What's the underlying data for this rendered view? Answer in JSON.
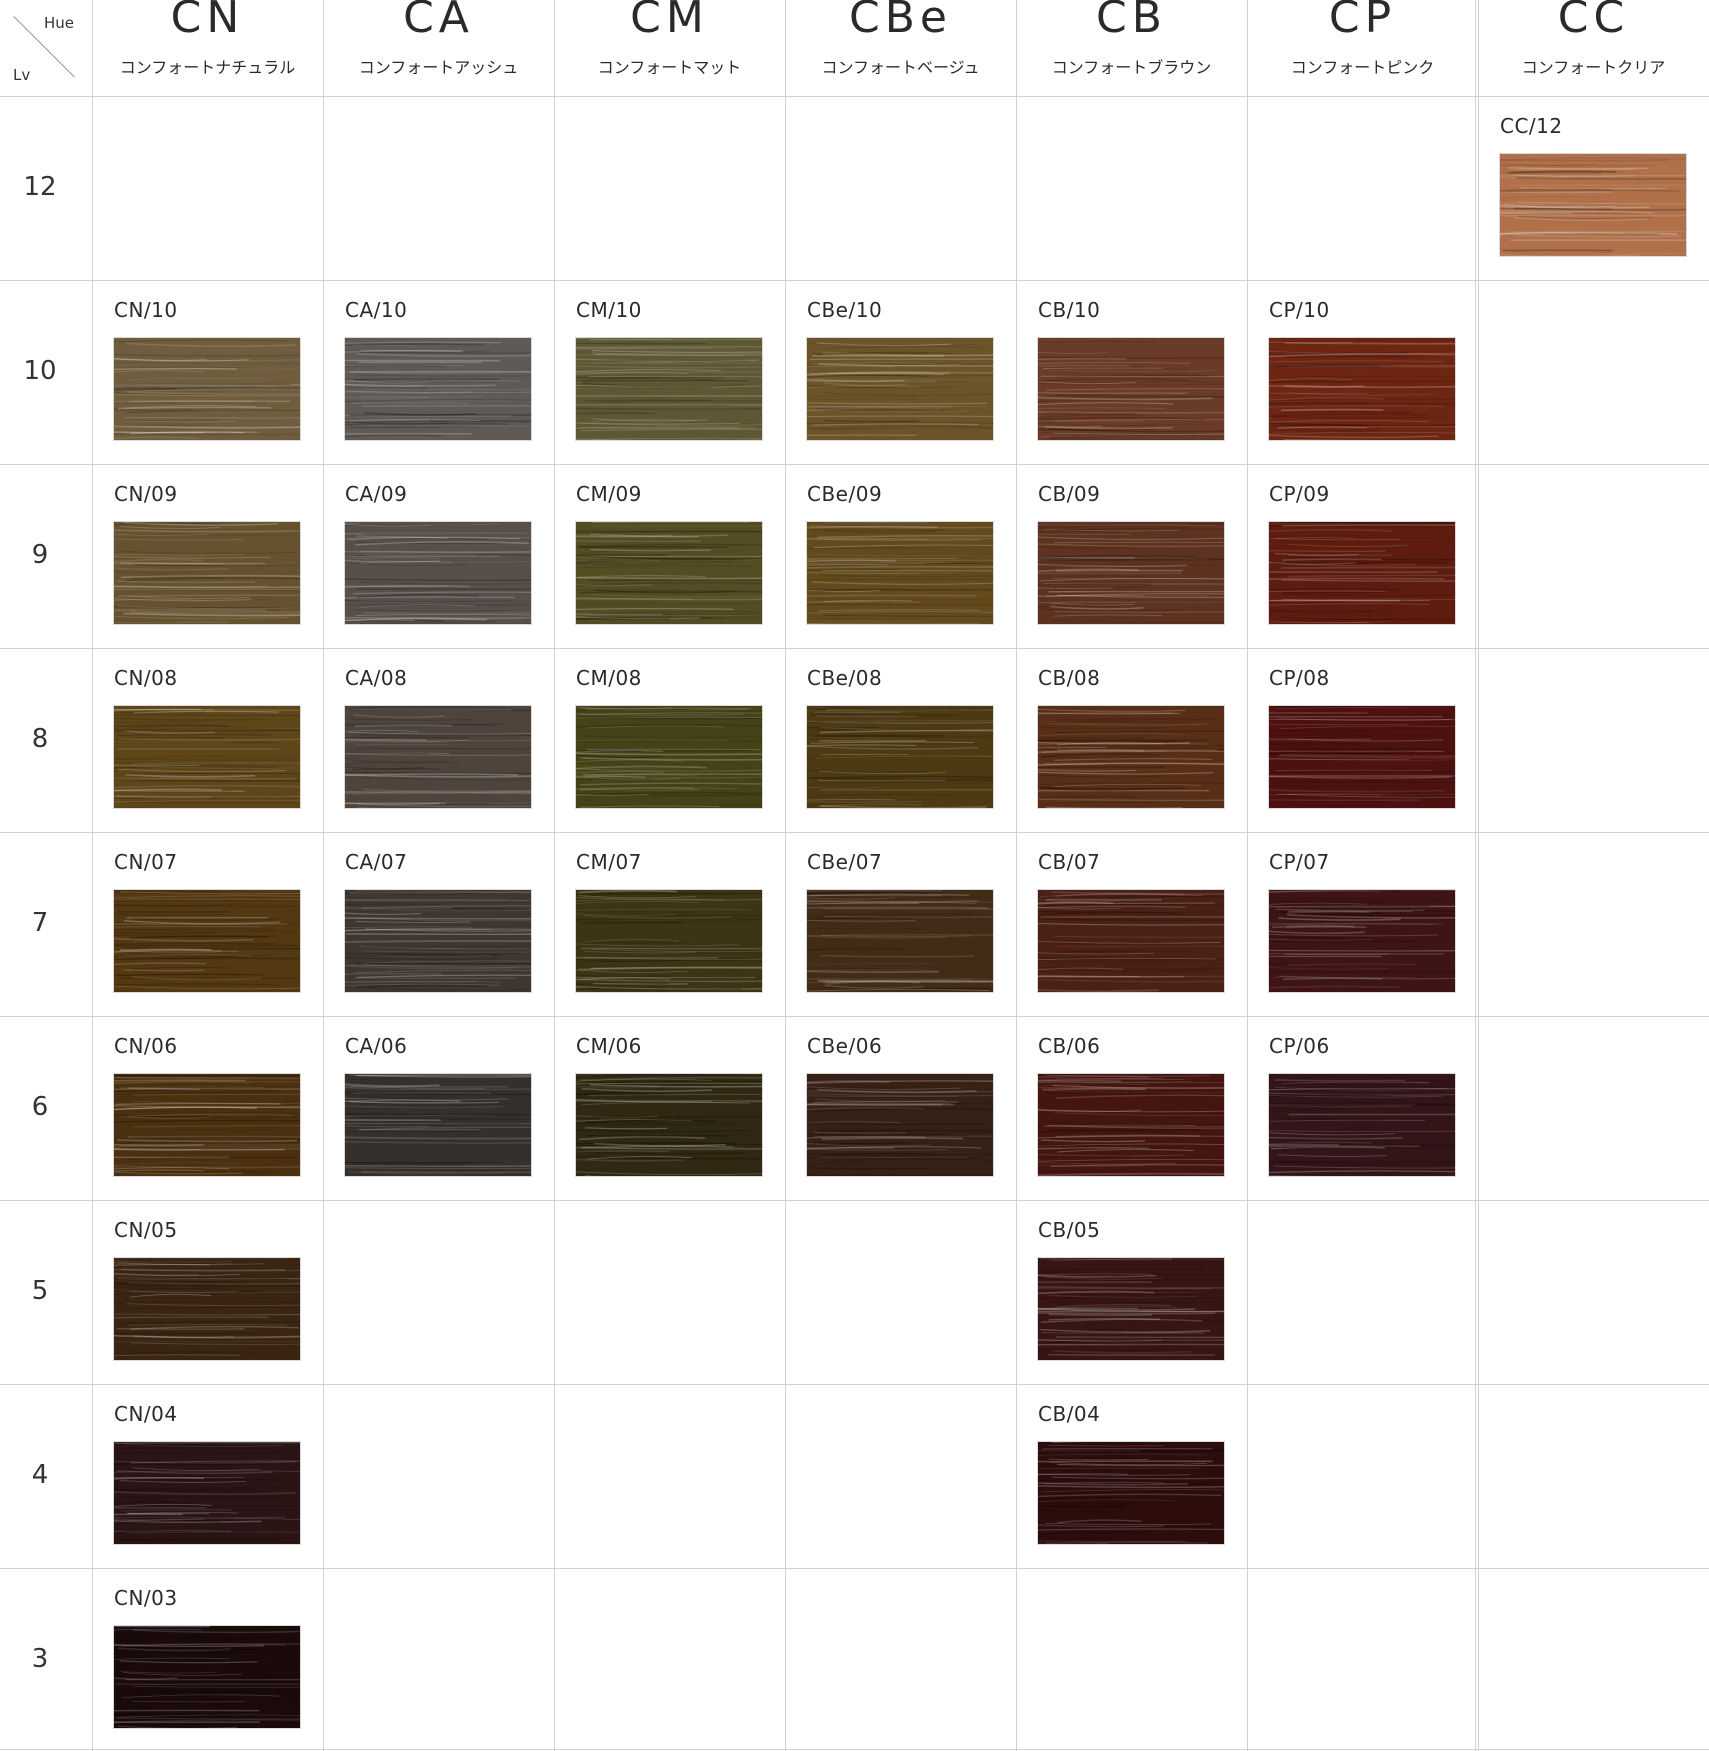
{
  "corner": {
    "hue_label": "Hue",
    "lv_label": "Lv"
  },
  "hues": [
    {
      "code": "CN",
      "name": "コンフォートナチュラル"
    },
    {
      "code": "CA",
      "name": "コンフォートアッシュ"
    },
    {
      "code": "CM",
      "name": "コンフォートマット"
    },
    {
      "code": "CBe",
      "name": "コンフォートベージュ"
    },
    {
      "code": "CB",
      "name": "コンフォートブラウン"
    },
    {
      "code": "CP",
      "name": "コンフォートピンク"
    },
    {
      "code": "CC",
      "name": "コンフォートクリア"
    }
  ],
  "levels": [
    "12",
    "10",
    "9",
    "8",
    "7",
    "6",
    "5",
    "4",
    "3"
  ],
  "swatches": [
    {
      "code": "CC/12",
      "hue": 6,
      "level": 0,
      "color": "#b0714a"
    },
    {
      "code": "CN/10",
      "hue": 0,
      "level": 1,
      "color": "#6f5d3e"
    },
    {
      "code": "CA/10",
      "hue": 1,
      "level": 1,
      "color": "#5f5a55"
    },
    {
      "code": "CM/10",
      "hue": 2,
      "level": 1,
      "color": "#5e5733"
    },
    {
      "code": "CBe/10",
      "hue": 3,
      "level": 1,
      "color": "#6b5428"
    },
    {
      "code": "CB/10",
      "hue": 4,
      "level": 1,
      "color": "#6a3b26"
    },
    {
      "code": "CP/10",
      "hue": 5,
      "level": 1,
      "color": "#6e2512"
    },
    {
      "code": "CN/09",
      "hue": 0,
      "level": 2,
      "color": "#66522f"
    },
    {
      "code": "CA/09",
      "hue": 1,
      "level": 2,
      "color": "#574f49"
    },
    {
      "code": "CM/09",
      "hue": 2,
      "level": 2,
      "color": "#544d24"
    },
    {
      "code": "CBe/09",
      "hue": 3,
      "level": 2,
      "color": "#624a1c"
    },
    {
      "code": "CB/09",
      "hue": 4,
      "level": 2,
      "color": "#5e3220"
    },
    {
      "code": "CP/09",
      "hue": 5,
      "level": 2,
      "color": "#5e1c10"
    },
    {
      "code": "CN/08",
      "hue": 0,
      "level": 3,
      "color": "#5e4619"
    },
    {
      "code": "CA/08",
      "hue": 1,
      "level": 3,
      "color": "#4f443c"
    },
    {
      "code": "CM/08",
      "hue": 2,
      "level": 3,
      "color": "#464217"
    },
    {
      "code": "CBe/08",
      "hue": 3,
      "level": 3,
      "color": "#4d3912"
    },
    {
      "code": "CB/08",
      "hue": 4,
      "level": 3,
      "color": "#592e16"
    },
    {
      "code": "CP/08",
      "hue": 5,
      "level": 3,
      "color": "#4d1210"
    },
    {
      "code": "CN/07",
      "hue": 0,
      "level": 4,
      "color": "#533812"
    },
    {
      "code": "CA/07",
      "hue": 1,
      "level": 4,
      "color": "#403630"
    },
    {
      "code": "CM/07",
      "hue": 2,
      "level": 4,
      "color": "#3c3414"
    },
    {
      "code": "CBe/07",
      "hue": 3,
      "level": 4,
      "color": "#432c17"
    },
    {
      "code": "CB/07",
      "hue": 4,
      "level": 4,
      "color": "#4b2115"
    },
    {
      "code": "CP/07",
      "hue": 5,
      "level": 4,
      "color": "#3e1414"
    },
    {
      "code": "CN/06",
      "hue": 0,
      "level": 5,
      "color": "#4b3010"
    },
    {
      "code": "CA/06",
      "hue": 1,
      "level": 5,
      "color": "#36302c"
    },
    {
      "code": "CM/06",
      "hue": 2,
      "level": 5,
      "color": "#302812"
    },
    {
      "code": "CBe/06",
      "hue": 3,
      "level": 5,
      "color": "#372116"
    },
    {
      "code": "CB/06",
      "hue": 4,
      "level": 5,
      "color": "#45150f"
    },
    {
      "code": "CP/06",
      "hue": 5,
      "level": 5,
      "color": "#331518"
    },
    {
      "code": "CN/05",
      "hue": 0,
      "level": 6,
      "color": "#3a2412"
    },
    {
      "code": "CB/05",
      "hue": 4,
      "level": 6,
      "color": "#371512"
    },
    {
      "code": "CN/04",
      "hue": 0,
      "level": 7,
      "color": "#2a1414"
    },
    {
      "code": "CB/04",
      "hue": 4,
      "level": 7,
      "color": "#2c0d0b"
    },
    {
      "code": "CN/03",
      "hue": 0,
      "level": 8,
      "color": "#1a0b0a"
    }
  ]
}
